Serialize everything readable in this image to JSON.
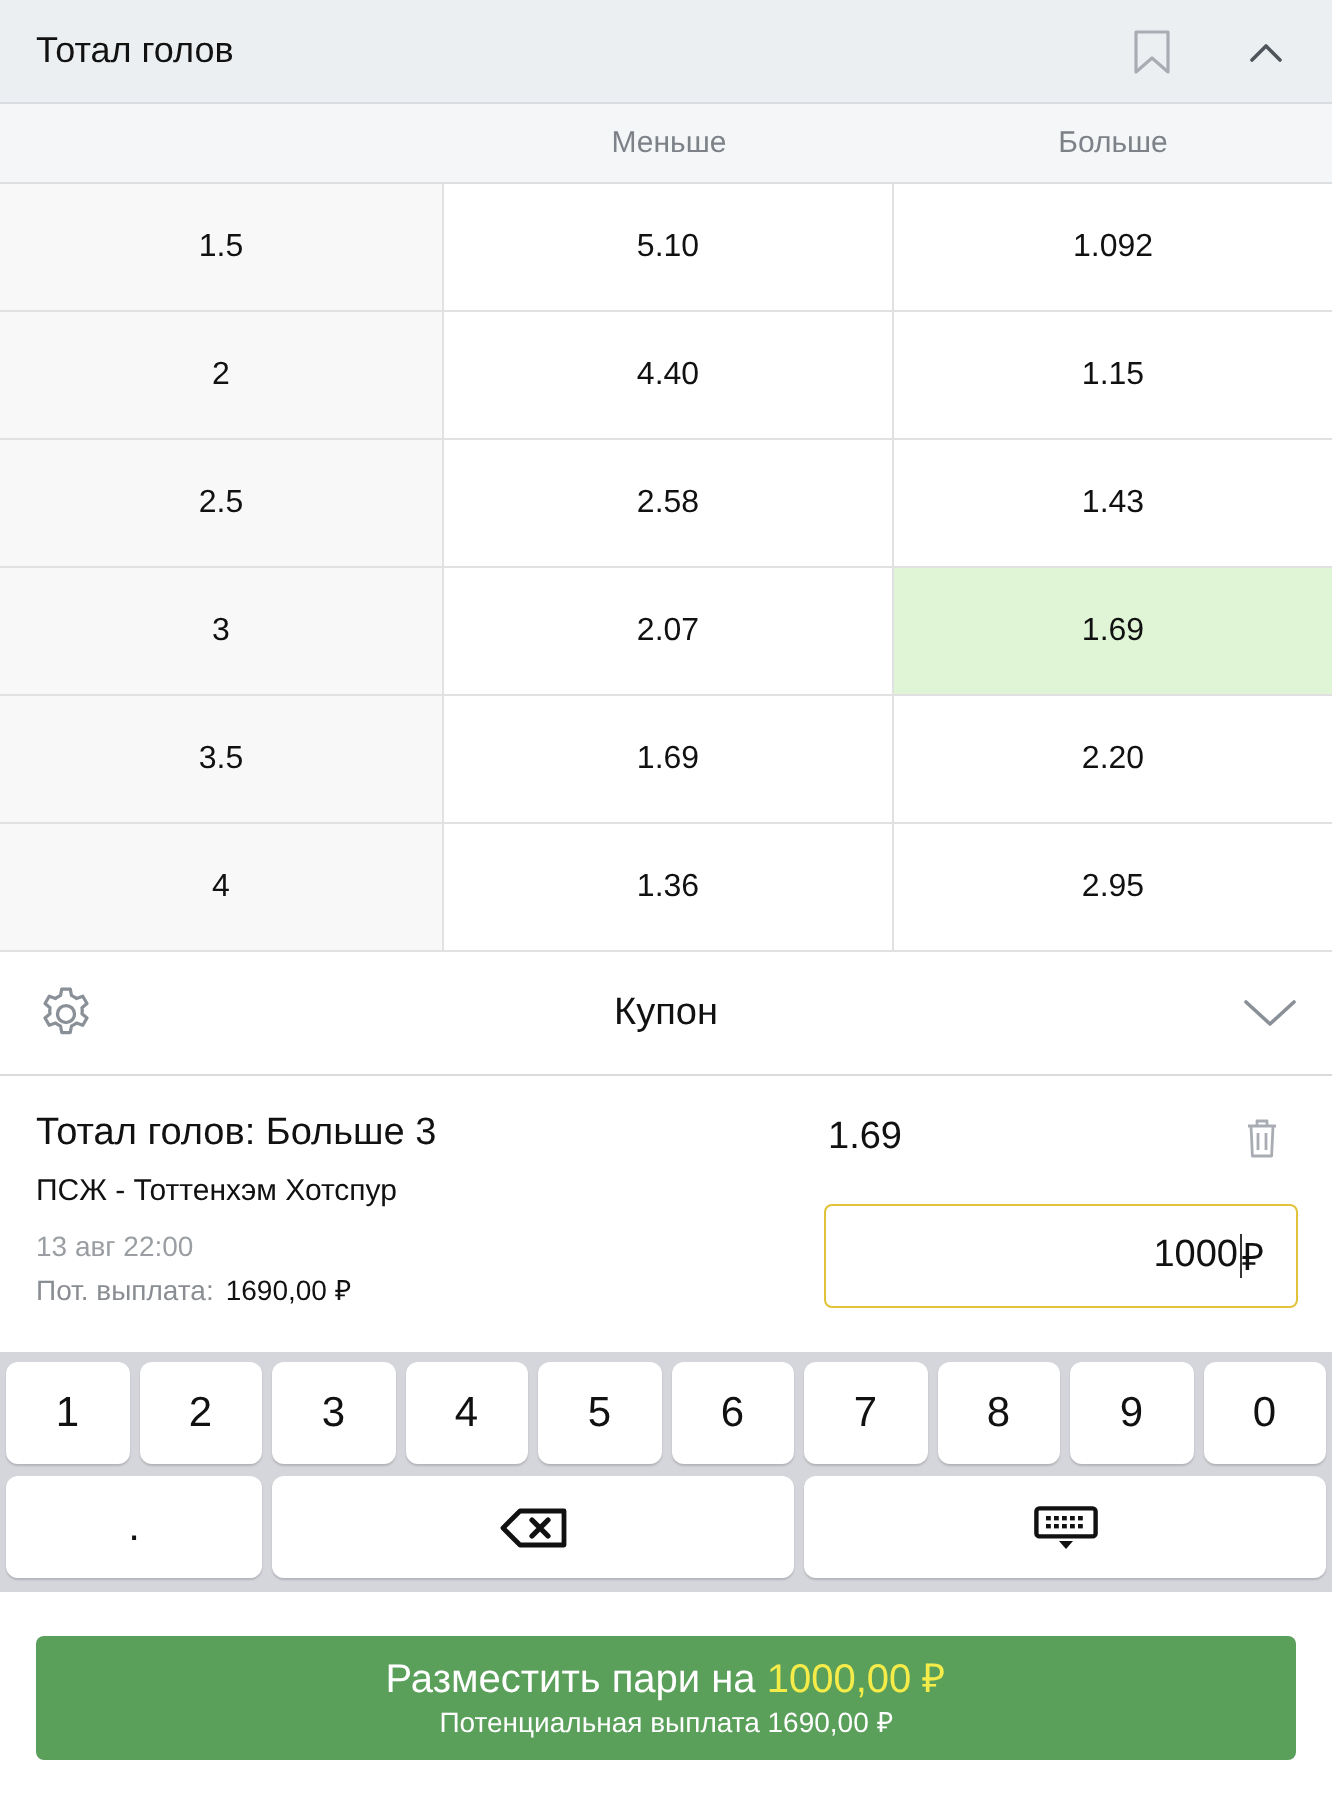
{
  "market": {
    "title": "Тотал голов",
    "expanded": true
  },
  "columns": [
    "Меньше",
    "Больше"
  ],
  "rows": [
    {
      "total": "1.5",
      "under": {
        "odds": "5.10",
        "selected": false
      },
      "over": {
        "odds": "1.092",
        "selected": false
      }
    },
    {
      "total": "2",
      "under": {
        "odds": "4.40",
        "selected": false
      },
      "over": {
        "odds": "1.15",
        "selected": false
      }
    },
    {
      "total": "2.5",
      "under": {
        "odds": "2.58",
        "selected": false
      },
      "over": {
        "odds": "1.43",
        "selected": false
      }
    },
    {
      "total": "3",
      "under": {
        "odds": "2.07",
        "selected": false
      },
      "over": {
        "odds": "1.69",
        "selected": true
      }
    },
    {
      "total": "3.5",
      "under": {
        "odds": "1.69",
        "selected": false
      },
      "over": {
        "odds": "2.20",
        "selected": false
      }
    },
    {
      "total": "4",
      "under": {
        "odds": "1.36",
        "selected": false
      },
      "over": {
        "odds": "2.95",
        "selected": false
      }
    }
  ],
  "coupon": {
    "title": "Купон",
    "bet": {
      "market": "Тотал голов: Больше 3",
      "odds": "1.69",
      "match": "ПСЖ - Тоттенхэм Хотспур",
      "date": "13 авг 22:00",
      "payout_label": "Пот. выплата:",
      "payout": "1690,00 ₽",
      "stake": {
        "value": "1000",
        "currency": "₽"
      }
    }
  },
  "keypad": [
    {
      "kind": "digit",
      "label": "1"
    },
    {
      "kind": "digit",
      "label": "2"
    },
    {
      "kind": "digit",
      "label": "3"
    },
    {
      "kind": "digit",
      "label": "4"
    },
    {
      "kind": "digit",
      "label": "5"
    },
    {
      "kind": "digit",
      "label": "6"
    },
    {
      "kind": "digit",
      "label": "7"
    },
    {
      "kind": "digit",
      "label": "8"
    },
    {
      "kind": "digit",
      "label": "9"
    },
    {
      "kind": "digit",
      "label": "0"
    },
    {
      "kind": "char",
      "label": "."
    },
    {
      "kind": "backspace"
    },
    {
      "kind": "hide"
    }
  ],
  "place_button": {
    "label": "Разместить пари на",
    "amount": "1000,00 ₽",
    "subtitle": "Потенциальная выплата 1690,00 ₽"
  }
}
